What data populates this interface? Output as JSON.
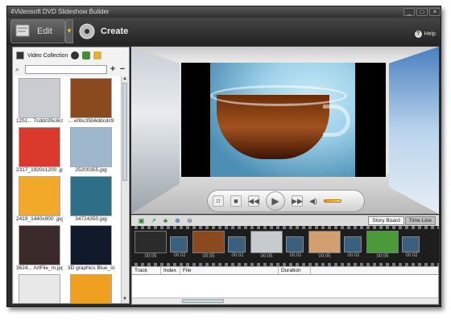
{
  "window": {
    "title": "4Videosoft DVD Slideshow Builder"
  },
  "toolbar": {
    "edit_label": "Edit",
    "create_label": "Create",
    "help_label": "Help"
  },
  "collection": {
    "title": "Video Collection",
    "search": {
      "value": "",
      "placeholder": ""
    },
    "items": [
      {
        "caption": "1251... 7cddc95c8c047b",
        "color": "#c9cdd2"
      },
      {
        "caption": "... e0bc35b6ddcdc9",
        "color": "#8a4a1e"
      },
      {
        "caption": "2317_1920x1200 .jpg",
        "color": "#d93a2c"
      },
      {
        "caption": "25200355.jpg",
        "color": "#9fb7cc"
      },
      {
        "caption": "2419_1440x900 .jpg",
        "color": "#f2a92a"
      },
      {
        "caption": "34724350.jpg",
        "color": "#2d6f86"
      },
      {
        "caption": "3624... ArtFile_m.jpg",
        "color": "#3a2a2a"
      },
      {
        "caption": "3D graphics Blue_st",
        "color": "#101a2a"
      },
      {
        "caption": "",
        "color": "#e8e8e8"
      },
      {
        "caption": "",
        "color": "#f0a020"
      }
    ]
  },
  "player": {
    "buttons": [
      "snapshot",
      "stop",
      "rewind",
      "play",
      "fast-forward",
      "volume"
    ]
  },
  "timeline": {
    "tabs": [
      {
        "label": "Story Board",
        "active": true
      },
      {
        "label": "Time Line",
        "active": false
      }
    ],
    "clips": [
      {
        "duration": "00:05",
        "color": "#2b2b2b"
      },
      {
        "duration": "00:05",
        "color": "#8a4a1e"
      },
      {
        "duration": "00:05",
        "color": "#c7cbd0"
      },
      {
        "duration": "00:05",
        "color": "#d2a070"
      },
      {
        "duration": "00:05",
        "color": "#4a9a3a"
      }
    ],
    "transitions": [
      {
        "duration": "00:02"
      },
      {
        "duration": "00:02"
      },
      {
        "duration": "00:02"
      },
      {
        "duration": "00:02"
      },
      {
        "duration": "00:02"
      }
    ]
  },
  "track_table": {
    "columns": [
      "Track",
      "Index",
      "File",
      "Duration"
    ]
  }
}
